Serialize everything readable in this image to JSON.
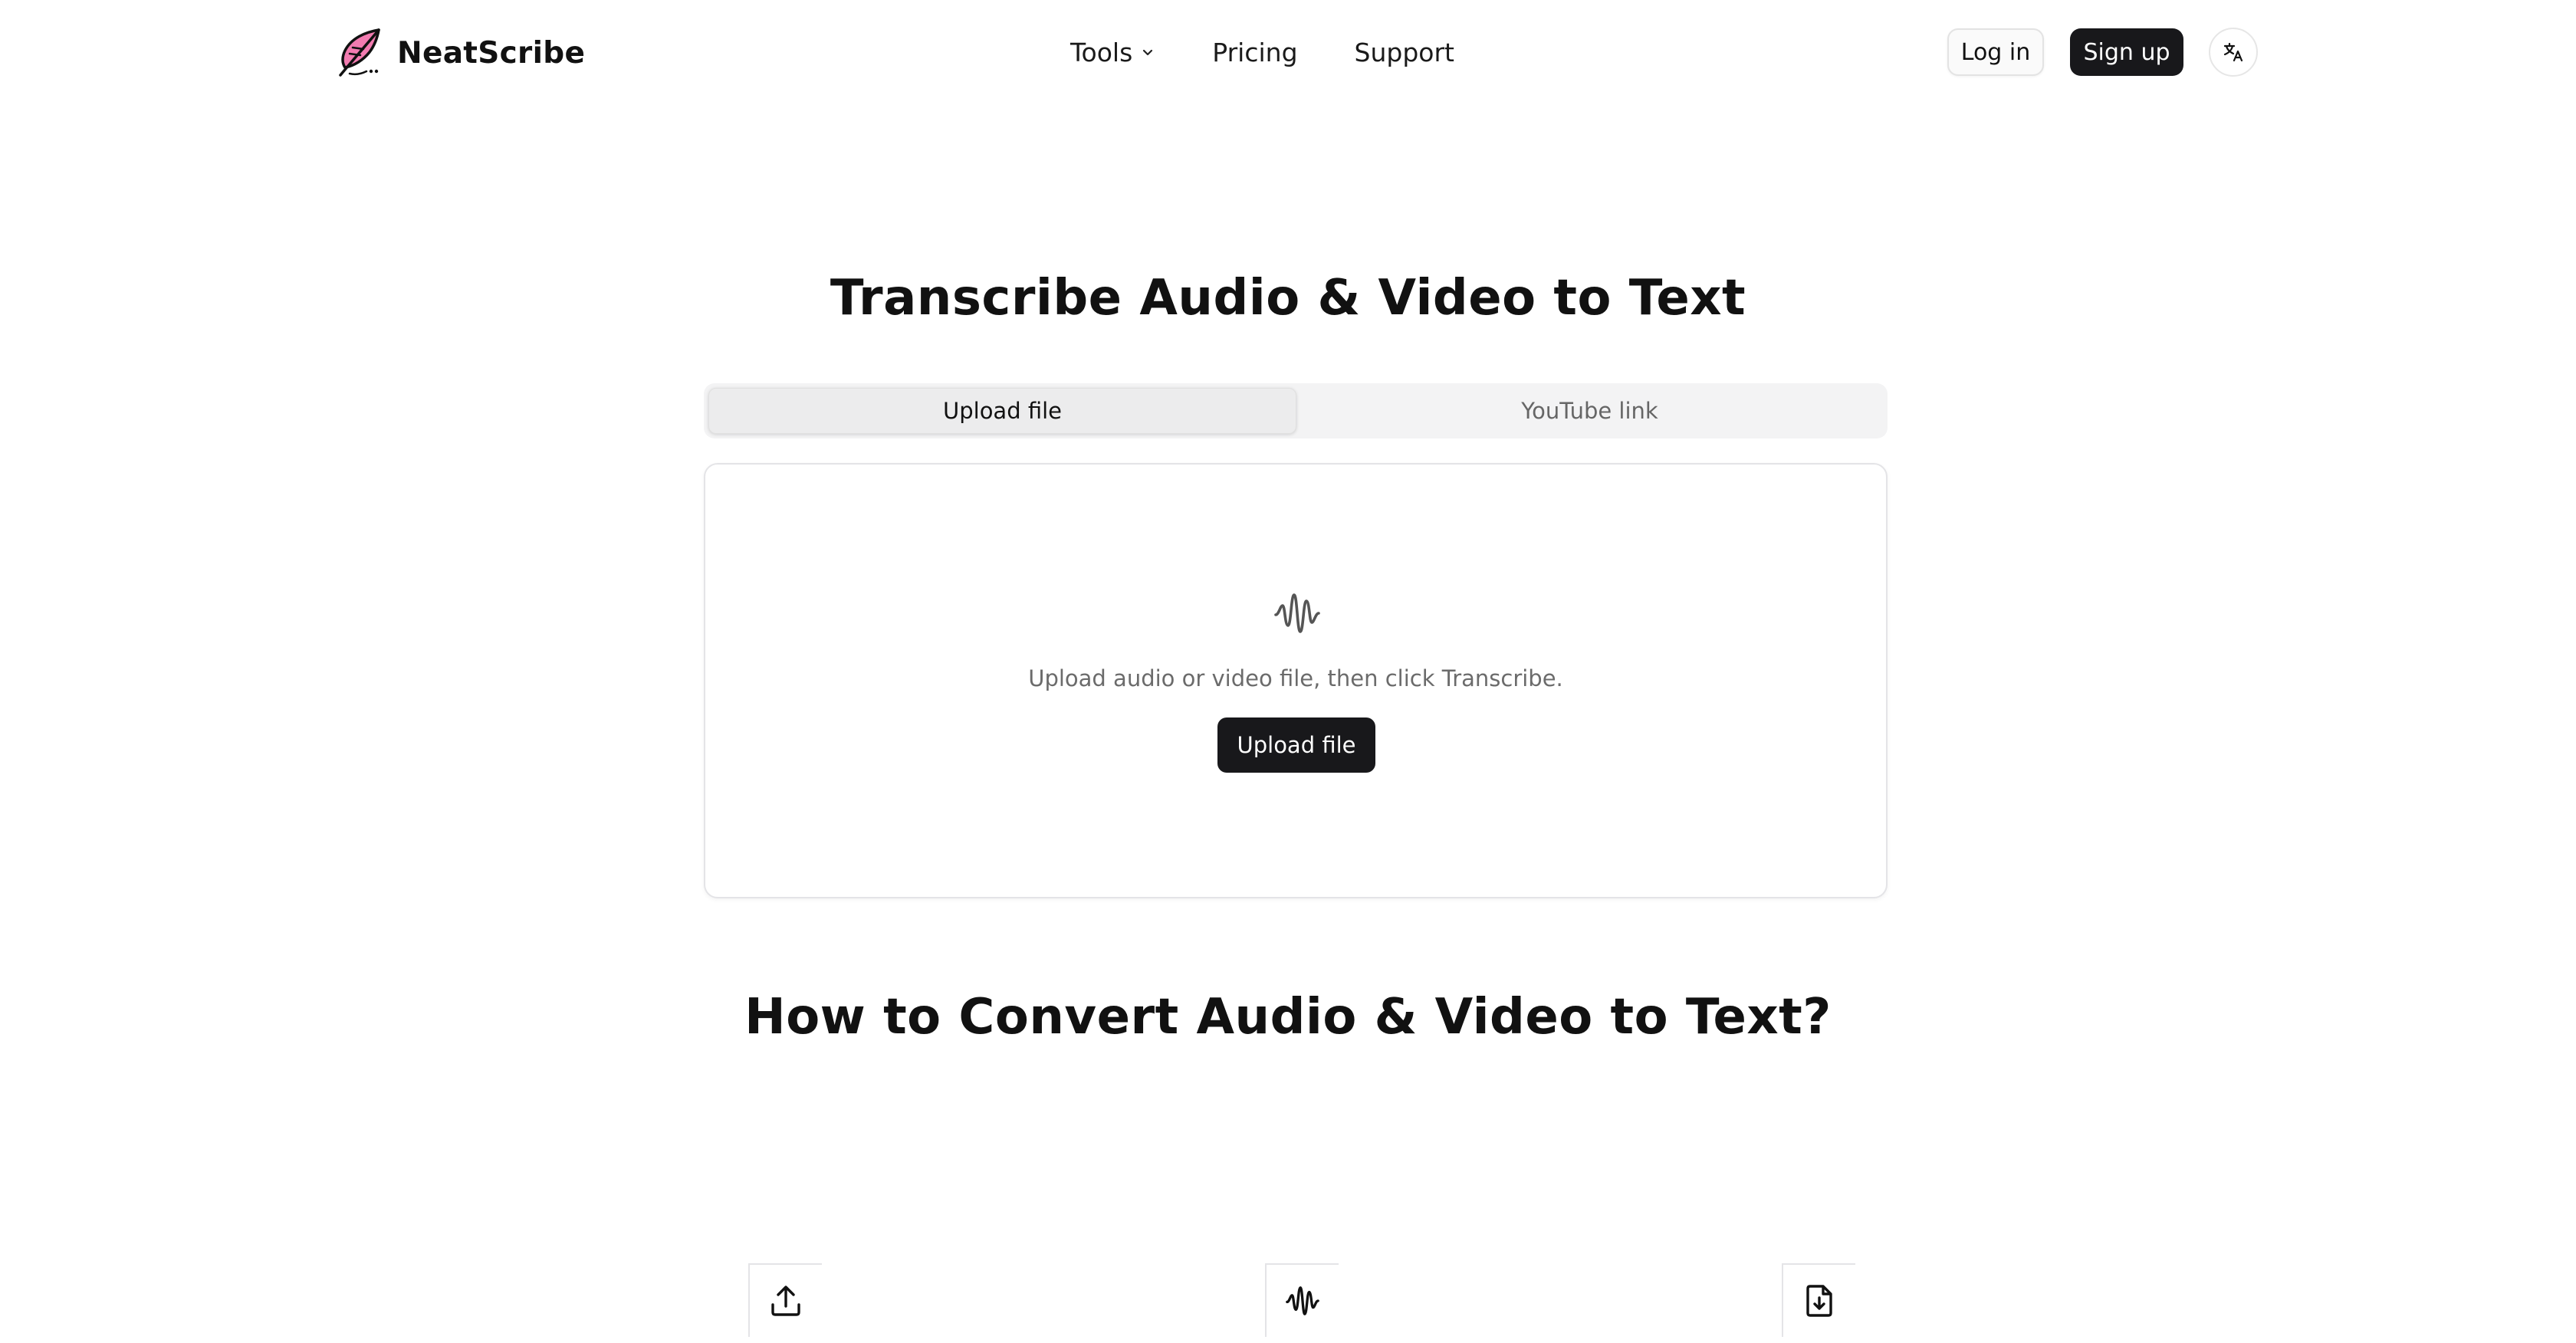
{
  "brand": {
    "name": "NeatScribe",
    "accent_color": "#f27bb0",
    "icon": "feather-quill-icon"
  },
  "nav": {
    "items": [
      {
        "label": "Tools",
        "icon": "chevron-down-icon"
      },
      {
        "label": "Pricing"
      },
      {
        "label": "Support"
      }
    ]
  },
  "header_actions": {
    "login_label": "Log in",
    "signup_label": "Sign up",
    "language_icon": "translate-icon"
  },
  "hero": {
    "title": "Transcribe Audio & Video to Text",
    "tabs": [
      {
        "label": "Upload file",
        "active": true
      },
      {
        "label": "YouTube link",
        "active": false
      }
    ],
    "dropzone": {
      "icon": "audio-waveform-icon",
      "instruction": "Upload audio or video file, then click Transcribe.",
      "button_label": "Upload file"
    }
  },
  "howto": {
    "title": "How to Convert Audio & Video to Text?",
    "steps": [
      {
        "icon": "upload-icon"
      },
      {
        "icon": "audio-waveform-icon"
      },
      {
        "icon": "file-download-icon"
      }
    ]
  },
  "colors": {
    "primary_button": "#18181b",
    "muted_text": "#6b6b6b",
    "tab_bg": "#f3f3f4"
  }
}
